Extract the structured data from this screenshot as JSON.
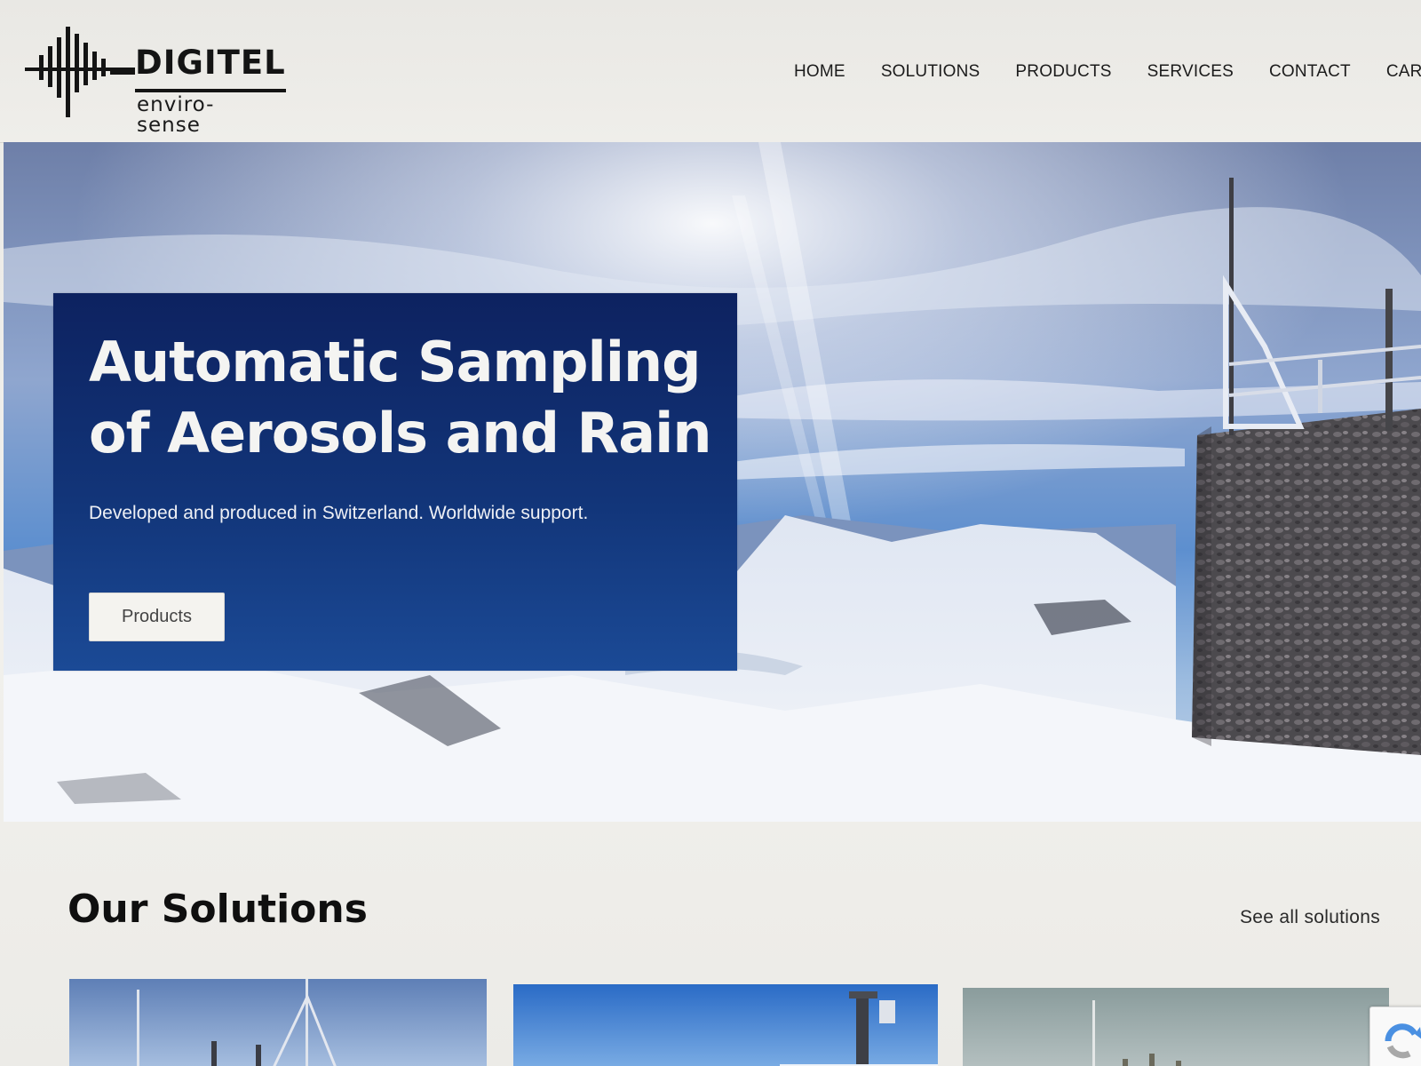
{
  "brand": {
    "name": "DIGITEL",
    "tagline": "enviro-sense"
  },
  "nav": {
    "items": [
      "HOME",
      "SOLUTIONS",
      "PRODUCTS",
      "SERVICES",
      "CONTACT",
      "CART"
    ]
  },
  "hero": {
    "title": "Automatic Sampling of Aerosols and Rain",
    "subtitle": "Developed and produced in Switzerland. Worldwide support.",
    "button_label": "Products"
  },
  "solutions": {
    "title": "Our Solutions",
    "see_all_label": "See all solutions"
  },
  "colors": {
    "hero_panel": "#123579",
    "text_dark": "#141414",
    "background": "#ecebe7"
  },
  "icons": [
    "digitel-logo-icon",
    "recaptcha-icon"
  ]
}
